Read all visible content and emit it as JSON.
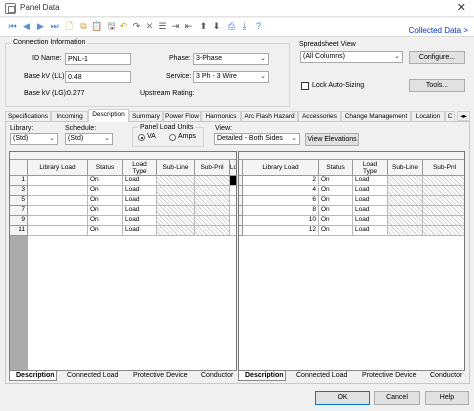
{
  "window": {
    "title": "Panel Data",
    "close_glyph": "✕"
  },
  "toolbar": {
    "collected_link": "Collected Data >",
    "icons": [
      "first-record-icon",
      "previous-record-icon",
      "next-record-icon",
      "last-record-icon",
      "new-icon",
      "copy-icon",
      "paste-icon",
      "save-icon",
      "undo-icon",
      "redo-icon",
      "delete-icon",
      "insert-row-icon",
      "add-row-icon",
      "delete-row-icon",
      "move-up-icon",
      "move-down-icon",
      "print-icon",
      "export-icon",
      "help-icon"
    ]
  },
  "connection": {
    "group_label": "Connection Information",
    "id_label": "ID Name:",
    "id_value": "PNL-1",
    "basekv_ll_label": "Base kV (LL):",
    "basekv_ll_value": "0.48",
    "basekv_lg_label": "Base kV (LG):",
    "basekv_lg_value": "0.277",
    "phase_label": "Phase:",
    "phase_value": "3-Phase",
    "service_label": "Service:",
    "service_value": "3 Ph - 3 Wire",
    "upstream_label": "Upstream Rating:"
  },
  "spreadsheet": {
    "group_label": "Spreadsheet View",
    "columns_value": "(All Columns)",
    "configure_label": "Configure...",
    "lock_label": "Lock Auto-Sizing",
    "tools_label": "Tools..."
  },
  "tabs": [
    "Specifications",
    "Incoming",
    "Description",
    "Summary",
    "Power Flow",
    "Harmonics",
    "Arc Flash Hazard",
    "Accessories",
    "Change Management",
    "Location",
    "C"
  ],
  "active_tab": "Description",
  "description": {
    "library_label": "Library:",
    "library_value": "(Std)",
    "schedule_label": "Schedule:",
    "schedule_value": "(Std)",
    "units_label": "Panel Load Units",
    "units_va": "VA",
    "units_amps": "Amps",
    "view_label": "View:",
    "view_value": "Detailed - Both Sides",
    "view_elevations_label": "View Elevations"
  },
  "grid_left": {
    "headers": [
      "Library Load",
      "Status",
      "Load\nType",
      "Sub-Line",
      "Sub-Pnl",
      "Lo"
    ],
    "rows": [
      {
        "num": "1",
        "status": "On",
        "type": "Load"
      },
      {
        "num": "3",
        "status": "On",
        "type": "Load"
      },
      {
        "num": "5",
        "status": "On",
        "type": "Load"
      },
      {
        "num": "7",
        "status": "On",
        "type": "Load"
      },
      {
        "num": "9",
        "status": "On",
        "type": "Load"
      },
      {
        "num": "11",
        "status": "On",
        "type": "Load"
      }
    ]
  },
  "grid_right": {
    "headers": [
      "Library Load",
      "Status",
      "Load\nType",
      "Sub-Line",
      "Sub-Pnl"
    ],
    "rows": [
      {
        "num": "2",
        "status": "On",
        "type": "Load"
      },
      {
        "num": "4",
        "status": "On",
        "type": "Load"
      },
      {
        "num": "6",
        "status": "On",
        "type": "Load"
      },
      {
        "num": "8",
        "status": "On",
        "type": "Load"
      },
      {
        "num": "10",
        "status": "On",
        "type": "Load"
      },
      {
        "num": "12",
        "status": "On",
        "type": "Load"
      }
    ]
  },
  "bottom_tabs": [
    "Description",
    "Connected Load",
    "Protective Device",
    "Conductor"
  ],
  "footer": {
    "ok_label": "OK",
    "cancel_label": "Cancel",
    "help_label": "Help"
  }
}
